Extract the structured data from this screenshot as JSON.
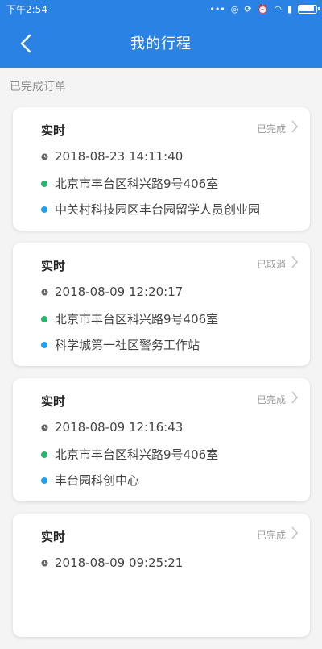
{
  "status_bar": {
    "time": "下午2:54",
    "icons": [
      "dots-icon",
      "circle-icon",
      "sync-icon",
      "alarm-icon",
      "wifi-icon",
      "signal-icon",
      "battery-icon"
    ]
  },
  "header": {
    "title": "我的行程",
    "back_icon": "chevron-left-icon"
  },
  "section": {
    "label": "已完成订单"
  },
  "colors": {
    "primary": "#2a82e4",
    "start_dot": "#2db36b",
    "end_dot": "#24a0e8"
  },
  "orders": [
    {
      "type": "实时",
      "status": "已完成",
      "time": "2018-08-23 14:11:40",
      "from": "北京市丰台区科兴路9号406室",
      "to": "中关村科技园区丰台园留学人员创业园"
    },
    {
      "type": "实时",
      "status": "已取消",
      "time": "2018-08-09 12:20:17",
      "from": "北京市丰台区科兴路9号406室",
      "to": "科学城第一社区警务工作站"
    },
    {
      "type": "实时",
      "status": "已完成",
      "time": "2018-08-09 12:16:43",
      "from": "北京市丰台区科兴路9号406室",
      "to": "丰台园科创中心"
    },
    {
      "type": "实时",
      "status": "已完成",
      "time": "2018-08-09 09:25:21",
      "from": "",
      "to": ""
    }
  ]
}
